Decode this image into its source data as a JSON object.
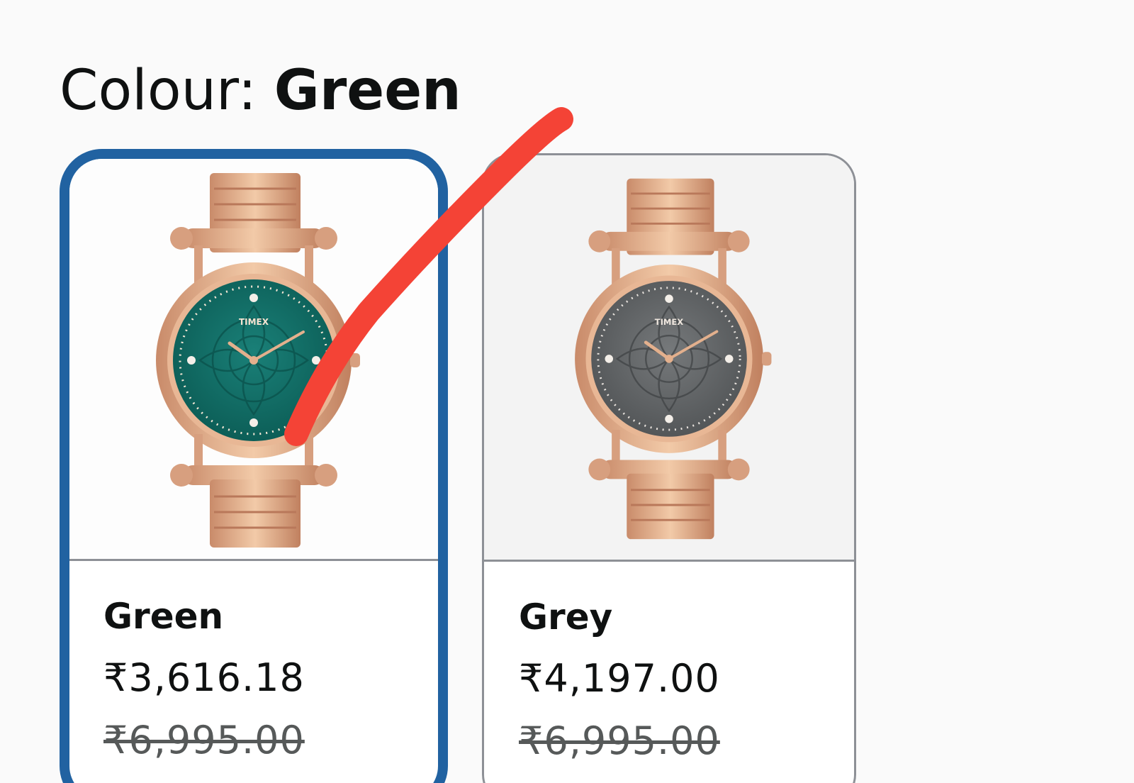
{
  "heading": {
    "label": "Colour: ",
    "selected_value": "Green"
  },
  "swatches": [
    {
      "name": "Green",
      "price": "₹3,616.18",
      "mrp": "₹6,995.00",
      "selected": true,
      "dial_color": "#0e6b63",
      "brand_text": "TIMEX"
    },
    {
      "name": "Grey",
      "price": "₹4,197.00",
      "mrp": "₹6,995.00",
      "selected": false,
      "dial_color": "#5f6264",
      "brand_text": "TIMEX"
    }
  ],
  "colors": {
    "selected_border": "#2162a1",
    "unselected_border": "#8d9096",
    "annotation_stroke": "#f44336",
    "watch_gold": "#d9a07e"
  }
}
